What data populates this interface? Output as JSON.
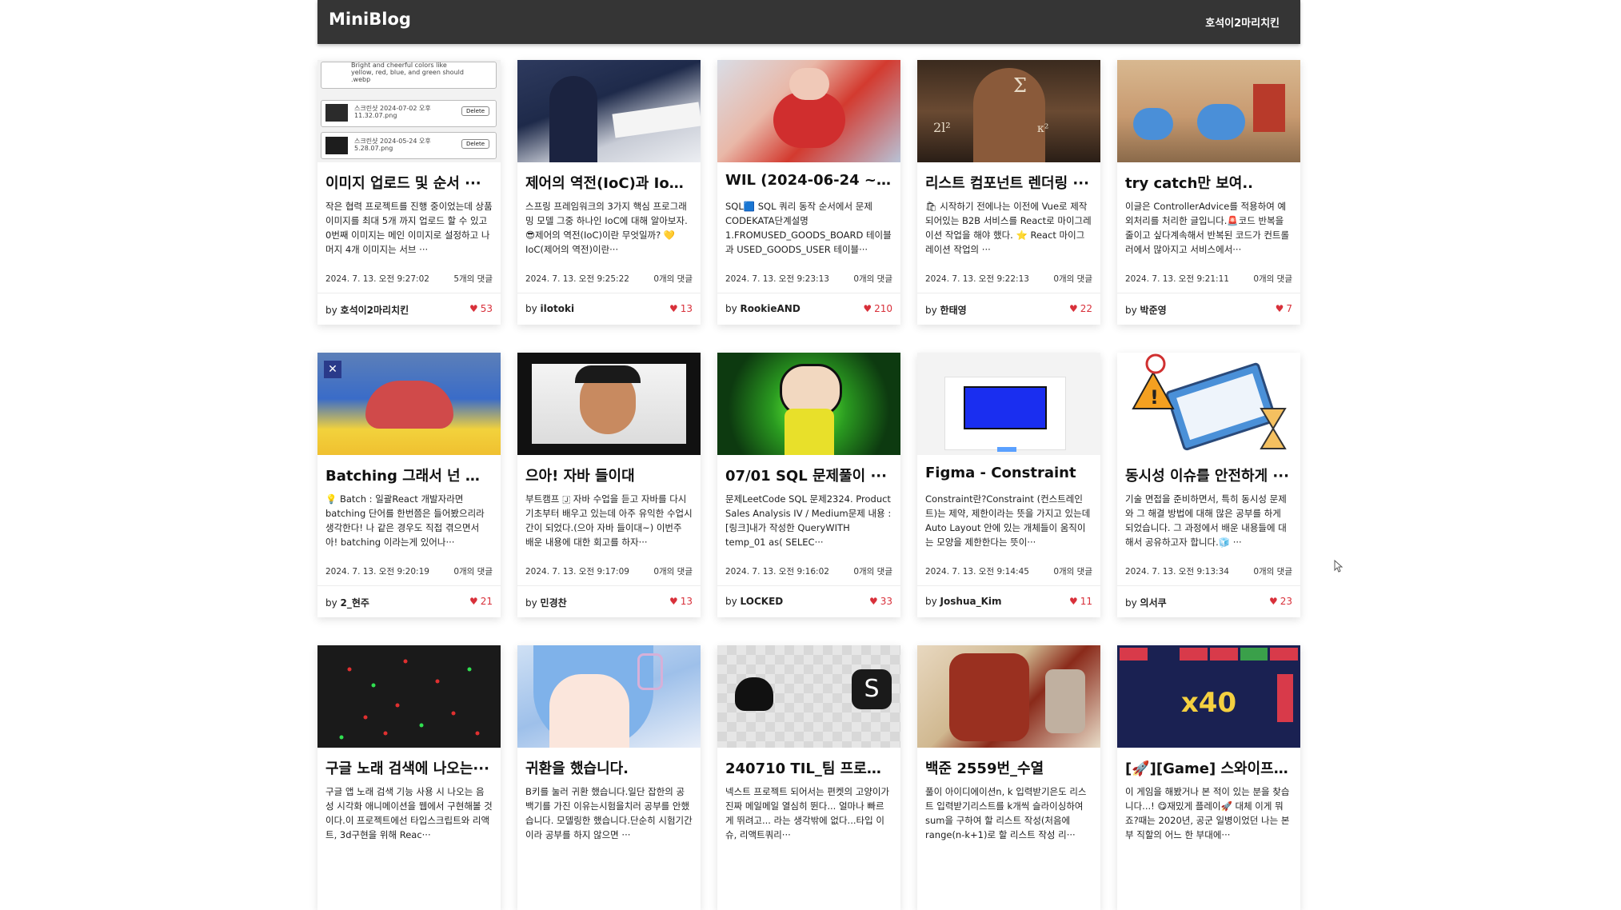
{
  "header": {
    "brand": "MiniBlog",
    "user": "호석이2마리치킨"
  },
  "colors": {
    "header_bg": "#353535",
    "like_red": "#d8303a"
  },
  "posts": [
    {
      "title": "이미지 업로드 및 순서 ···",
      "excerpt": "작은 협력 프로젝트를 진행 중이었는데 상품 이미지를 최대 5개 까지 업로드 할 수 있고 0번째 이미지는 메인 이미지로 설정하고 나머지 4개 이미지는 서브 ···",
      "date": "2024. 7. 13. 오전 9:27:02",
      "comments": "5개의 댓글",
      "author": "호석이2마리치킨",
      "likes": "53",
      "thumb_text": [
        "Bright and cheerful colors like yellow, red, blue, and green should .webp",
        "스크린샷 2024-07-02 오후 11.32.07.png",
        "스크린샷 2024-05-24 오후 5.28.07.png",
        "Delete"
      ]
    },
    {
      "title": "제어의 역전(IoC)과 IoC···",
      "excerpt": "스프링 프레임워크의 3가지 핵심 프로그래밍 모델 그중 하나인 IoC에 대해 알아보자. 😎제어의 역전(IoC)이란 무엇일까? 💛IoC(제어의 역전)이란···",
      "date": "2024. 7. 13. 오전 9:25:22",
      "comments": "0개의 댓글",
      "author": "ilotoki",
      "likes": "13"
    },
    {
      "title": "WIL (2024-06-24 ~···",
      "excerpt": "SQL🟦 SQL 쿼리 동작 순서에서 문제 CODEKATA단계설명 1.FROMUSED_GOODS_BOARD 테이블과 USED_GOODS_USER 테이블···",
      "date": "2024. 7. 13. 오전 9:23:13",
      "comments": "0개의 댓글",
      "author": "RookieAND",
      "likes": "210"
    },
    {
      "title": "리스트 컴포넌트 렌더링 ···",
      "excerpt": "🛍 시작하기 전에나는 이전에 Vue로 제작되어있는 B2B 서비스를 React로 마이그레이션 작업을 해야 했다. ⭐ React 마이그레이션 작업의 ···",
      "date": "2024. 7. 13. 오전 9:22:13",
      "comments": "0개의 댓글",
      "author": "한태영",
      "likes": "22"
    },
    {
      "title": "try catch만 보여..",
      "excerpt": "이글은 ControllerAdvice를 적용하여 예외처리를 처리한 글입니다.🚨코드 반복을 줄이고 싶다계속해서 반복된 코드가 컨트롤러에서 많아지고 서비스에서···",
      "date": "2024. 7. 13. 오전 9:21:11",
      "comments": "0개의 댓글",
      "author": "박준영",
      "likes": "7"
    },
    {
      "title": "Batching 그래서 넌 뭔···",
      "excerpt": "💡 Batch : 일괄React 개발자라면 batching 단어를 한번쯤은 들어봤으리라 생각한다! 나 같은 경우도 직접 겪으면서 아! batching 이라는게 있어나···",
      "date": "2024. 7. 13. 오전 9:20:19",
      "comments": "0개의 댓글",
      "author": "2_현주",
      "likes": "21"
    },
    {
      "title": "으아! 자바 들이대",
      "excerpt": "부트캠프 🇯 자바 수업을 듣고 자바를 다시 기초부터 배우고 있는데 아주 유익한 수업시간이 되었다.(으아 자바 들이대~) 이번주 배운 내용에 대한 회고를 하자···",
      "date": "2024. 7. 13. 오전 9:17:09",
      "comments": "0개의 댓글",
      "author": "민경찬",
      "likes": "13"
    },
    {
      "title": "07/01 SQL 문제풀이 ···",
      "excerpt": "문제LeetCode SQL 문제2324. Product Sales Analysis IV / Medium문제 내용 : [링크]내가 작성한 QueryWITH temp_01 as( SELEC···",
      "date": "2024. 7. 13. 오전 9:16:02",
      "comments": "0개의 댓글",
      "author": "LOCKED",
      "likes": "33"
    },
    {
      "title": "Figma - Constraint",
      "excerpt": "Constraint란?Constraint (컨스트레인트)는 제약, 제한이라는 뜻을 가지고 있는데 Auto Layout 안에 있는 개체들이 움직이는 모양을 제한한다는 뜻이···",
      "date": "2024. 7. 13. 오전 9:14:45",
      "comments": "0개의 댓글",
      "author": "Joshua_Kim",
      "likes": "11"
    },
    {
      "title": "동시성 이슈를 안전하게 ···",
      "excerpt": "기술 면접을 준비하면서, 특히 동시성 문제와 그 해결 방법에 대해 많은 공부를 하게 되었습니다. 그 과정에서 배운 내용들에 대해서 공유하고자 합니다.🧊 ···",
      "date": "2024. 7. 13. 오전 9:13:34",
      "comments": "0개의 댓글",
      "author": "의서쿠",
      "likes": "23"
    },
    {
      "title": "구글 노래 검색에 나오는···",
      "excerpt": "구글 앱 노래 검색 기능 사용 시 나오는 음성 시각화 애니메이션을 웹에서 구현해볼 것이다.이 프로젝트에선 타입스크립트와 리액트, 3d구현을 위해 Reac···",
      "date": "",
      "comments": "",
      "author": "",
      "likes": ""
    },
    {
      "title": "귀환을 했습니다.",
      "excerpt": "B키를 눌러 귀환 했습니다.일단 잡한의 공백기를 가진 이유는시험을치러 공부를 안했습니다. 모델링한 했습니다.단순히 시험기간이라 공부를 하지 않으면 ···",
      "date": "",
      "comments": "",
      "author": "",
      "likes": ""
    },
    {
      "title": "240710 TIL_팀 프로젝···",
      "excerpt": "넥스트 프로젝트 되어서는 편켓의 고양이가 진짜 메일메일 열심히 뛴다... 얼마나 빠르게 뛰려고... 라는 생각밖에 없다...타입 이슈, 리액트쿼리···",
      "date": "",
      "comments": "",
      "author": "",
      "likes": ""
    },
    {
      "title": "백준 2559번_수열",
      "excerpt": "풀이 아이디에이션n, k 입력받기은도 리스트 입력받기리스트를 k개씩 슬라이싱하여 sum을 구하여 할 리스트 작성(처음에 range(n-k+1)로 할 리스트 작성 리···",
      "date": "",
      "comments": "",
      "author": "",
      "likes": ""
    },
    {
      "title": "[🚀][Game] 스와이프 ···",
      "excerpt": "이 게임을 해봤거나 본 적이 있는 분을 찾습니다...! 😋재밌게 플레이🚀 대체 이게 뭐죠?때는 2020년, 공군 일병이었던 나는 본부 직할의 어느 한 부대에···",
      "date": "",
      "comments": "",
      "author": "",
      "likes": "",
      "thumb_text": [
        "x40"
      ]
    }
  ]
}
